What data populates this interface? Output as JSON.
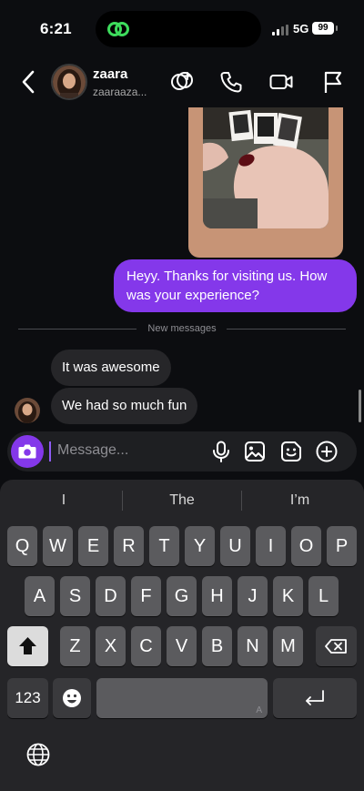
{
  "status_bar": {
    "time": "6:21",
    "network": "5G",
    "battery": "99"
  },
  "header": {
    "name": "zaara",
    "username": "zaaraaza..."
  },
  "chat": {
    "outgoing_message": "Heyy. Thanks for visiting us. How was your experience?",
    "new_messages_label": "New messages",
    "incoming": [
      "It was awesome",
      "We had so much fun"
    ]
  },
  "composer": {
    "placeholder": "Message..."
  },
  "keyboard": {
    "suggestions": [
      "I",
      "The",
      "I’m"
    ],
    "row1": [
      "Q",
      "W",
      "E",
      "R",
      "T",
      "Y",
      "U",
      "I",
      "O",
      "P"
    ],
    "row2": [
      "A",
      "S",
      "D",
      "F",
      "G",
      "H",
      "J",
      "K",
      "L"
    ],
    "row3": [
      "Z",
      "X",
      "C",
      "V",
      "B",
      "N",
      "M"
    ],
    "numbers_label": "123",
    "space_hint": "A"
  },
  "colors": {
    "accent": "#8438ea",
    "background": "#0c0d10",
    "incoming_bubble": "#262629",
    "keyboard": "#252528"
  }
}
